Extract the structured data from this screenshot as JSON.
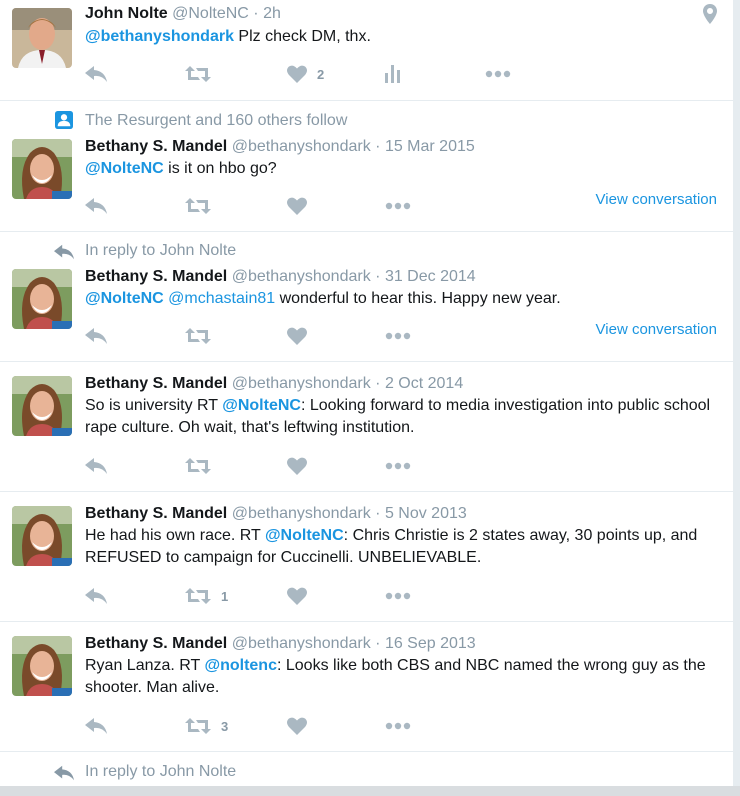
{
  "colors": {
    "link": "#1b95e0",
    "muted": "#8899a6",
    "icon": "#aab8c2",
    "border": "#e6ecf0"
  },
  "tweets": [
    {
      "name": "John Nolte",
      "handle": "@NolteNC",
      "time": "2h",
      "mention": "@bethanyshondark",
      "text_rest": " Plz check DM, thx.",
      "likes": "2",
      "icons": [
        "reply-icon",
        "retweet-icon",
        "heart-icon",
        "analytics-icon",
        "more-icon",
        "location-pin-icon"
      ]
    },
    {
      "context": "The Resurgent and 160 others follow",
      "name": "Bethany S. Mandel",
      "handle": "@bethanyshondark",
      "time": "15 Mar 2015",
      "mention": "@NolteNC",
      "text_rest": " is it on hbo go?",
      "view_conversation": "View conversation"
    },
    {
      "context": "In reply to John Nolte",
      "name": "Bethany S. Mandel",
      "handle": "@bethanyshondark",
      "time": "31 Dec 2014",
      "mention": "@NolteNC",
      "mention2": "@mchastain81",
      "text_rest": " wonderful to hear this. Happy new year.",
      "view_conversation": "View conversation"
    },
    {
      "name": "Bethany S. Mandel",
      "handle": "@bethanyshondark",
      "time": "2 Oct 2014",
      "text_pre": "So is university RT ",
      "mention": "@NolteNC",
      "text_rest": ": Looking forward to media investigation into public school rape culture. Oh wait, that's leftwing institution."
    },
    {
      "name": "Bethany S. Mandel",
      "handle": "@bethanyshondark",
      "time": "5 Nov 2013",
      "text_pre": "He had his own race. RT ",
      "mention": "@NolteNC",
      "text_rest": ": Chris Christie is 2 states away, 30 points up, and REFUSED to campaign for Cuccinelli. UNBELIEVABLE.",
      "retweets": "1"
    },
    {
      "name": "Bethany S. Mandel",
      "handle": "@bethanyshondark",
      "time": "16 Sep 2013",
      "text_pre": "Ryan Lanza. RT ",
      "mention": "@noltenc",
      "text_rest": ": Looks like both CBS and NBC named the wrong guy as the shooter. Man alive.",
      "retweets": "3"
    }
  ],
  "footer_context": "In reply to John Nolte",
  "separator": "·"
}
